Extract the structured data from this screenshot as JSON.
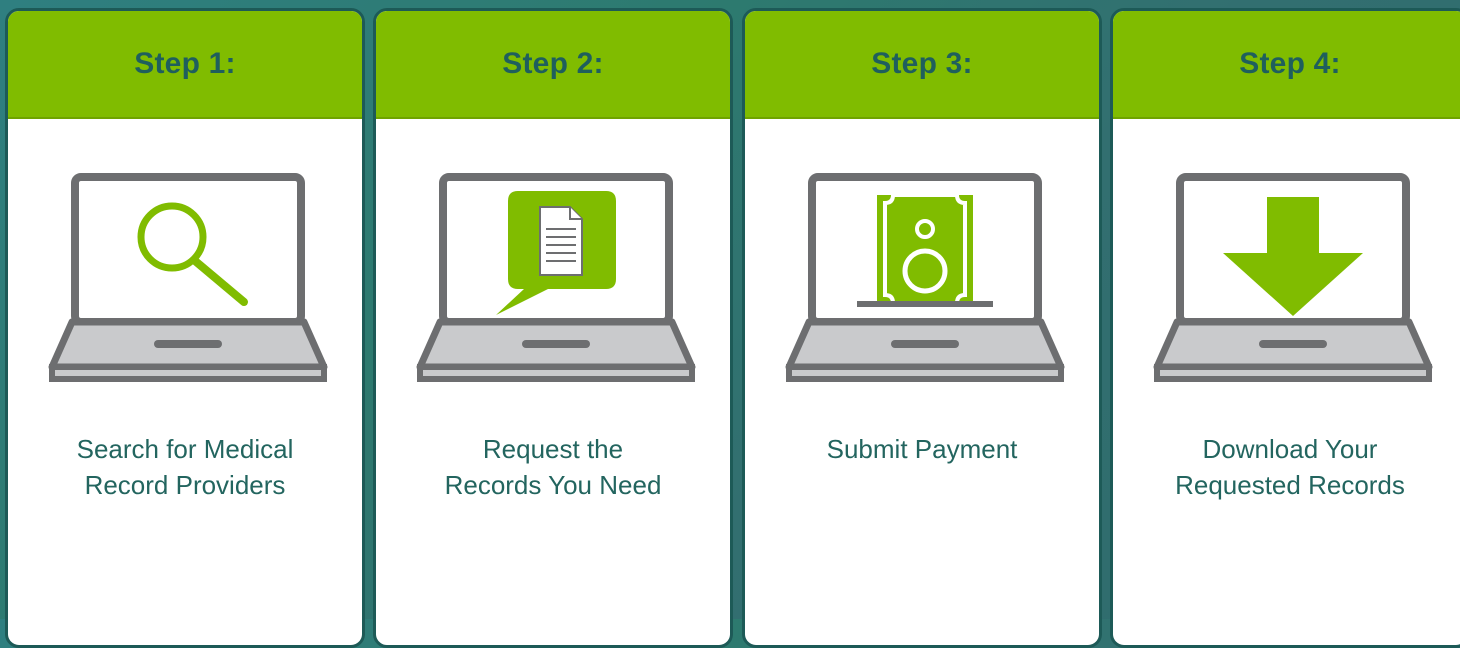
{
  "colors": {
    "accent_green": "#80bc00",
    "icon_green": "#80bc00",
    "header_text": "#1f5f5d",
    "body_text": "#23655f",
    "laptop_gray": "#6d6e70",
    "laptop_light": "#c9cacc",
    "background": "#2f7f80"
  },
  "steps": [
    {
      "title": "Step 1:",
      "icon": "magnifying-glass-icon",
      "lines": [
        "Search for Medical",
        "Record Providers"
      ]
    },
    {
      "title": "Step 2:",
      "icon": "document-speech-bubble-icon",
      "lines": [
        "Request the",
        "Records You Need"
      ]
    },
    {
      "title": "Step 3:",
      "icon": "money-bill-icon",
      "lines": [
        "Submit Payment"
      ]
    },
    {
      "title": "Step 4:",
      "icon": "download-arrow-icon",
      "lines": [
        "Download Your",
        "Requested Records"
      ]
    }
  ]
}
